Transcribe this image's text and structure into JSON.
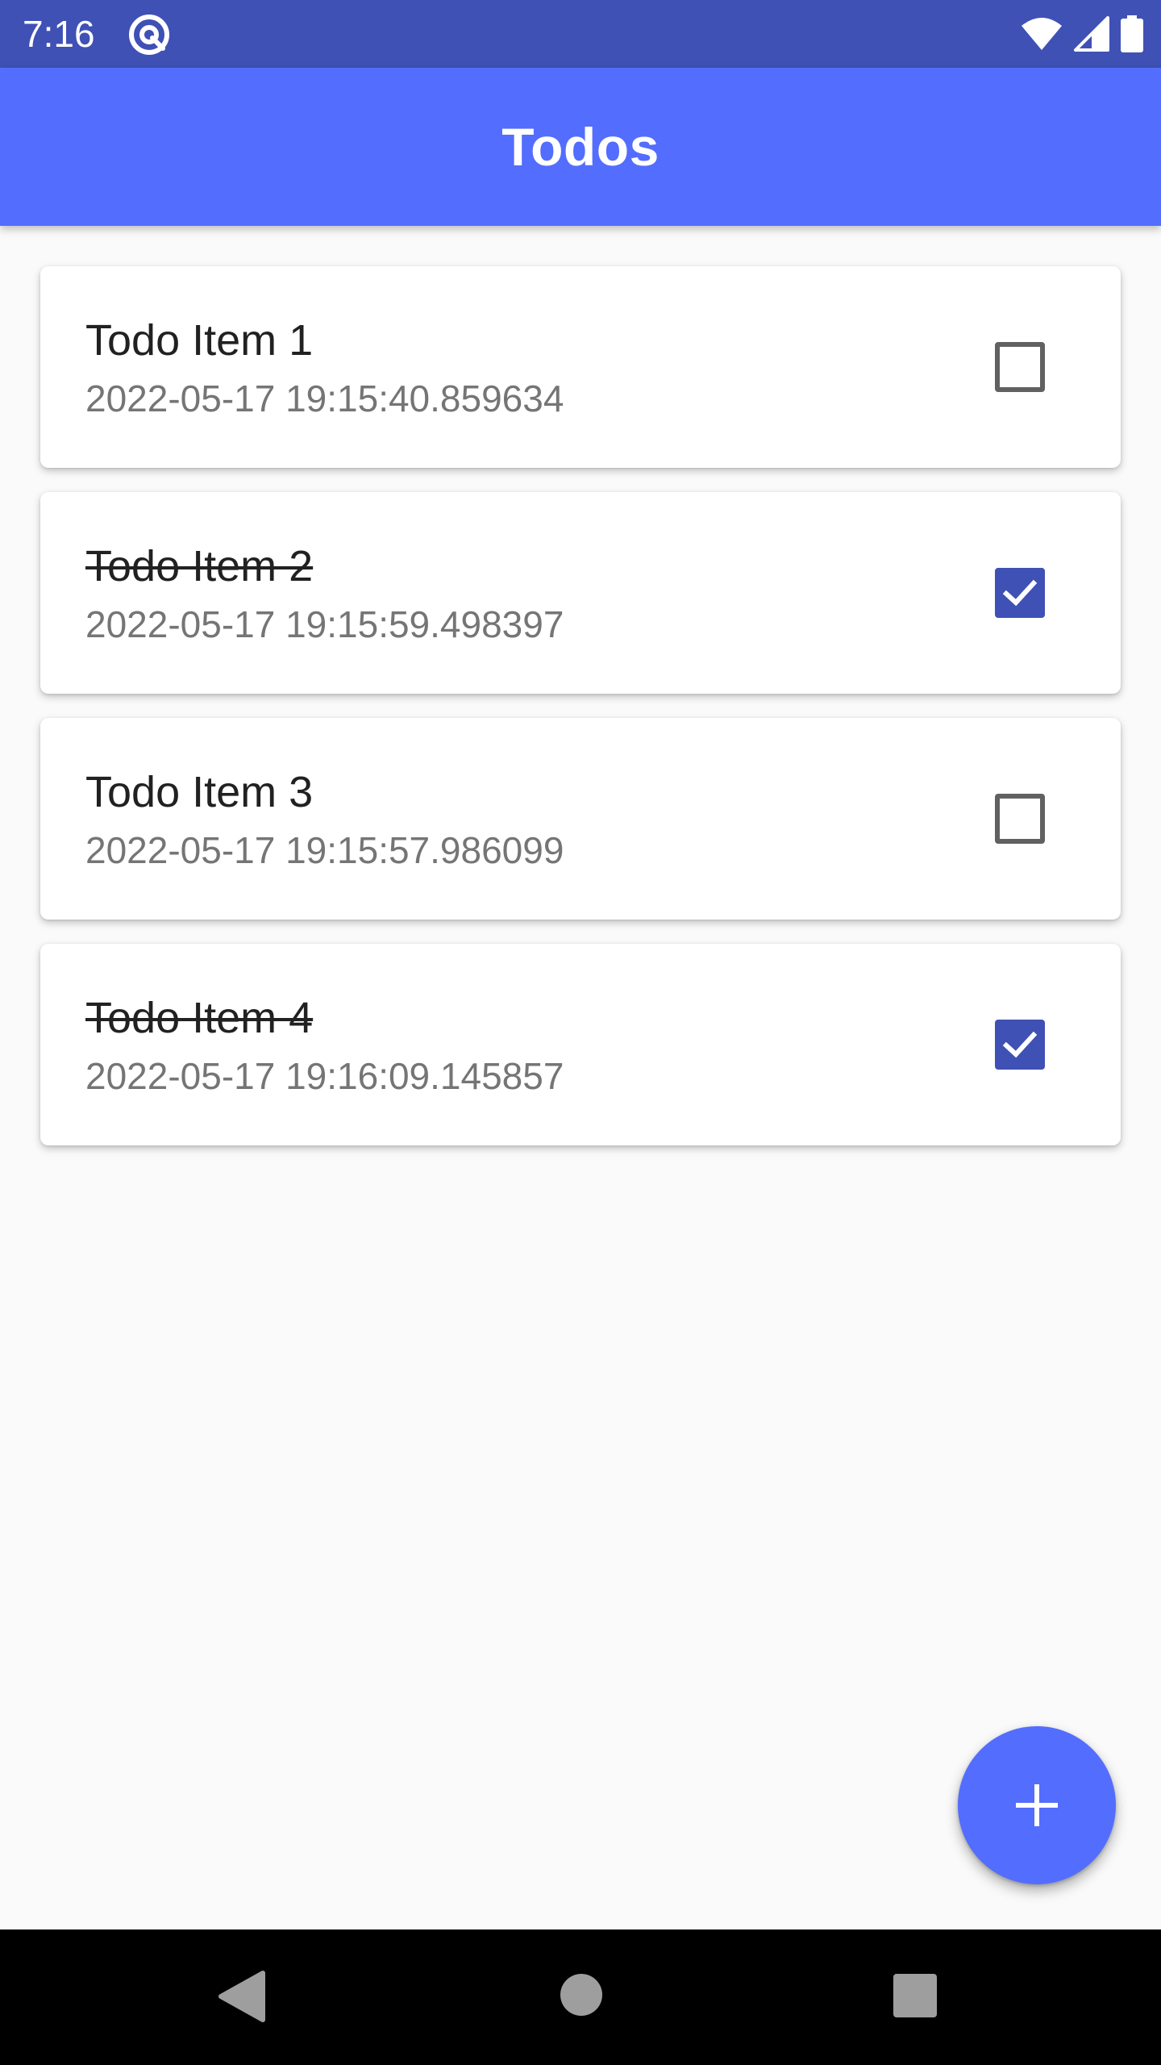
{
  "status_bar": {
    "time": "7:16",
    "app_icon": "q-at-icon",
    "wifi_icon": "wifi-icon",
    "signal_icon": "cell-signal-icon",
    "battery_icon": "battery-icon",
    "color": "#3F51B5"
  },
  "app_bar": {
    "title": "Todos",
    "color": "#536DFE"
  },
  "todos": [
    {
      "title": "Todo Item 1",
      "date": "2022-05-17 19:15:40.859634",
      "checked": false
    },
    {
      "title": "Todo Item 2",
      "date": "2022-05-17 19:15:59.498397",
      "checked": true
    },
    {
      "title": "Todo Item 3",
      "date": "2022-05-17 19:15:57.986099",
      "checked": false
    },
    {
      "title": "Todo Item 4",
      "date": "2022-05-17 19:16:09.145857",
      "checked": true
    }
  ],
  "fab": {
    "icon": "plus-icon",
    "color": "#536DFE"
  },
  "nav_bar": {
    "back_icon": "back-triangle-icon",
    "home_icon": "home-circle-icon",
    "recents_icon": "recents-square-icon"
  },
  "colors": {
    "checkbox_checked": "#3F51B5",
    "checkbox_unchecked_border": "#616161",
    "background": "#FAFAFA"
  }
}
